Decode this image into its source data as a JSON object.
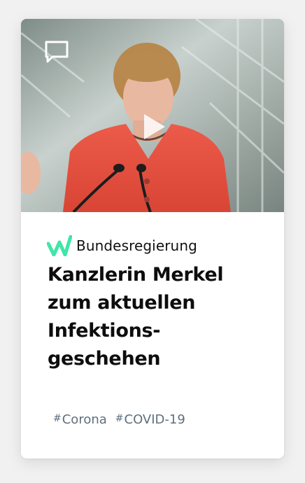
{
  "card": {
    "media": {
      "comment_icon": "speech-bubble-icon",
      "play_icon": "play-icon"
    },
    "source": {
      "logo_icon": "w-logo-icon",
      "name": "Bundesregierung",
      "brand_color": "#3ee6a8"
    },
    "headline": {
      "lines": [
        "Kanzlerin Merkel",
        "zum aktuellen",
        "Infektions-",
        "geschehen"
      ]
    },
    "tags": [
      {
        "hash": "#",
        "label": "Corona"
      },
      {
        "hash": "#",
        "label": "COVID-19"
      }
    ]
  }
}
